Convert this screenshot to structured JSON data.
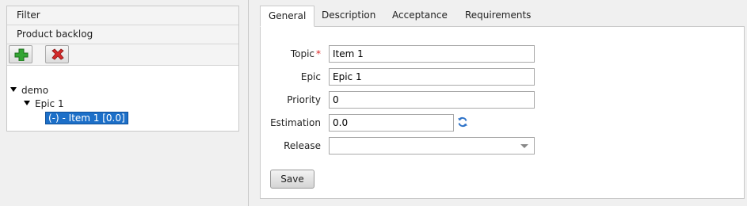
{
  "left": {
    "filter_label": "Filter",
    "backlog_label": "Product backlog",
    "toolbar": {
      "add_icon": "add-icon",
      "delete_icon": "delete-icon"
    },
    "tree": {
      "root": "demo",
      "epic": "Epic 1",
      "item": "(-) - Item 1 [0.0]"
    }
  },
  "tabs": [
    "General",
    "Description",
    "Acceptance",
    "Requirements"
  ],
  "form": {
    "topic": {
      "label": "Topic",
      "required_mark": "*",
      "value": "Item 1"
    },
    "epic": {
      "label": "Epic",
      "value": "Epic 1"
    },
    "priority": {
      "label": "Priority",
      "value": "0"
    },
    "estimation": {
      "label": "Estimation",
      "value": "0.0",
      "icon": "refresh-icon"
    },
    "release": {
      "label": "Release",
      "value": ""
    },
    "save_label": "Save"
  },
  "colors": {
    "selection": "#1c6fc8",
    "required": "#dd2222",
    "add_icon": "#2f9e2f",
    "delete_icon": "#d42a2a",
    "refresh_icon": "#2e73c8"
  }
}
